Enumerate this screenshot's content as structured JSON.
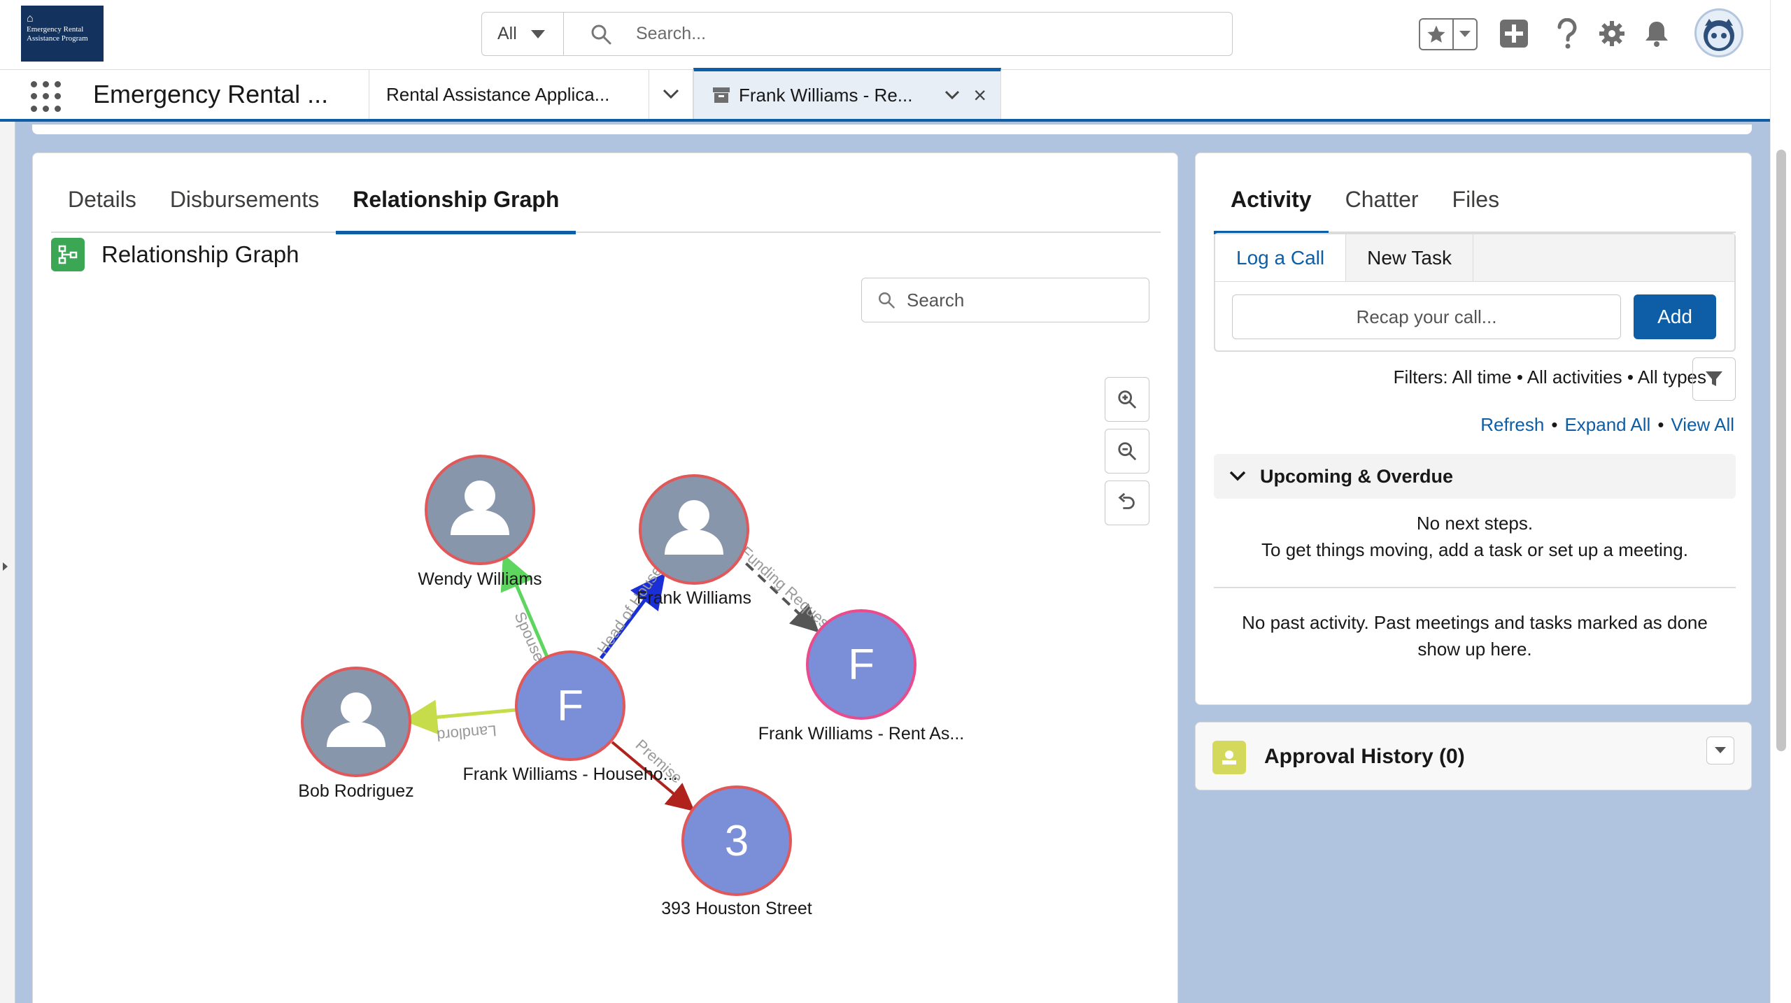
{
  "header": {
    "logo_text": "Emergency Rental Assistance Program",
    "search": {
      "scope": "All",
      "placeholder": "Search..."
    }
  },
  "nav": {
    "app_name": "Emergency Rental ...",
    "tabs": [
      {
        "label": "Rental Assistance Applica..."
      },
      {
        "label": "Frank Williams - Re..."
      }
    ]
  },
  "record_tabs": [
    "Details",
    "Disbursements",
    "Relationship Graph"
  ],
  "graph": {
    "title": "Relationship Graph",
    "search_placeholder": "Search",
    "nodes": [
      {
        "id": "wendy",
        "label": "Wendy Williams",
        "kind": "person"
      },
      {
        "id": "frank_contact",
        "label": "Frank Williams",
        "kind": "person"
      },
      {
        "id": "frank_rent",
        "label": "Frank Williams - Rent As...",
        "kind": "letter",
        "letter": "F"
      },
      {
        "id": "bob",
        "label": "Bob Rodriguez",
        "kind": "person"
      },
      {
        "id": "household",
        "label": "Frank Williams - Househo...",
        "kind": "letter",
        "letter": "F"
      },
      {
        "id": "premise",
        "label": "393 Houston Street",
        "kind": "letter",
        "letter": "3"
      }
    ],
    "edges": [
      {
        "from": "household",
        "to": "wendy",
        "label": "Spouse",
        "color": "#5ed55e"
      },
      {
        "from": "household",
        "to": "frank_contact",
        "label": "Head of Household",
        "color": "#1a2fd6"
      },
      {
        "from": "frank_contact",
        "to": "frank_rent",
        "label": "Funding Request",
        "color": "#555555"
      },
      {
        "from": "household",
        "to": "bob",
        "label": "Landlord",
        "color": "#c6dc4a"
      },
      {
        "from": "household",
        "to": "premise",
        "label": "Premise",
        "color": "#b0231d"
      }
    ]
  },
  "activity": {
    "tabs": [
      "Activity",
      "Chatter",
      "Files"
    ],
    "composer_tabs": [
      "Log a Call",
      "New Task"
    ],
    "recap_placeholder": "Recap your call...",
    "add_label": "Add",
    "filters": "Filters: All time • All activities • All types",
    "links": [
      "Refresh",
      "Expand All",
      "View All"
    ],
    "upcoming_title": "Upcoming & Overdue",
    "no_steps_line1": "No next steps.",
    "no_steps_line2": "To get things moving, add a task or set up a meeting.",
    "no_past_line1": "No past activity. Past meetings and tasks marked as done",
    "no_past_line2": "show up here."
  },
  "approval": {
    "title": "Approval History (0)"
  },
  "colors": {
    "brand": "#0d5ea6",
    "node_person": "#8796aa",
    "node_letter": "#7b8ed8",
    "node_border": "#e0585a",
    "node_border_rent": "#e94b8c"
  }
}
